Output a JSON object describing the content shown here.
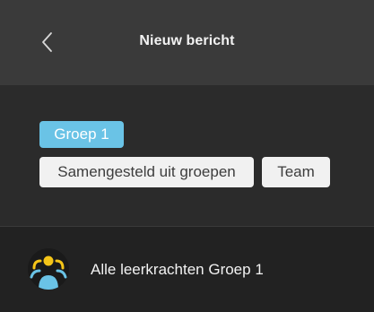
{
  "header": {
    "title": "Nieuw bericht",
    "back_icon": "chevron-left-icon"
  },
  "filters": {
    "chips": [
      {
        "label": "Groep 1",
        "selected": true
      },
      {
        "label": "Samengesteld uit groepen",
        "selected": false
      },
      {
        "label": "Team",
        "selected": false
      }
    ]
  },
  "recipients": [
    {
      "label": "Alle leerkrachten Groep 1",
      "icon": "group-avatar-icon"
    }
  ],
  "colors": {
    "accent": "#6ac3e6",
    "header_bg": "#3a3a3a",
    "body_bg": "#2b2b2b",
    "chip_bg": "#f1f1f1",
    "avatar_yellow": "#f5c518",
    "avatar_blue": "#6ac3e6"
  }
}
